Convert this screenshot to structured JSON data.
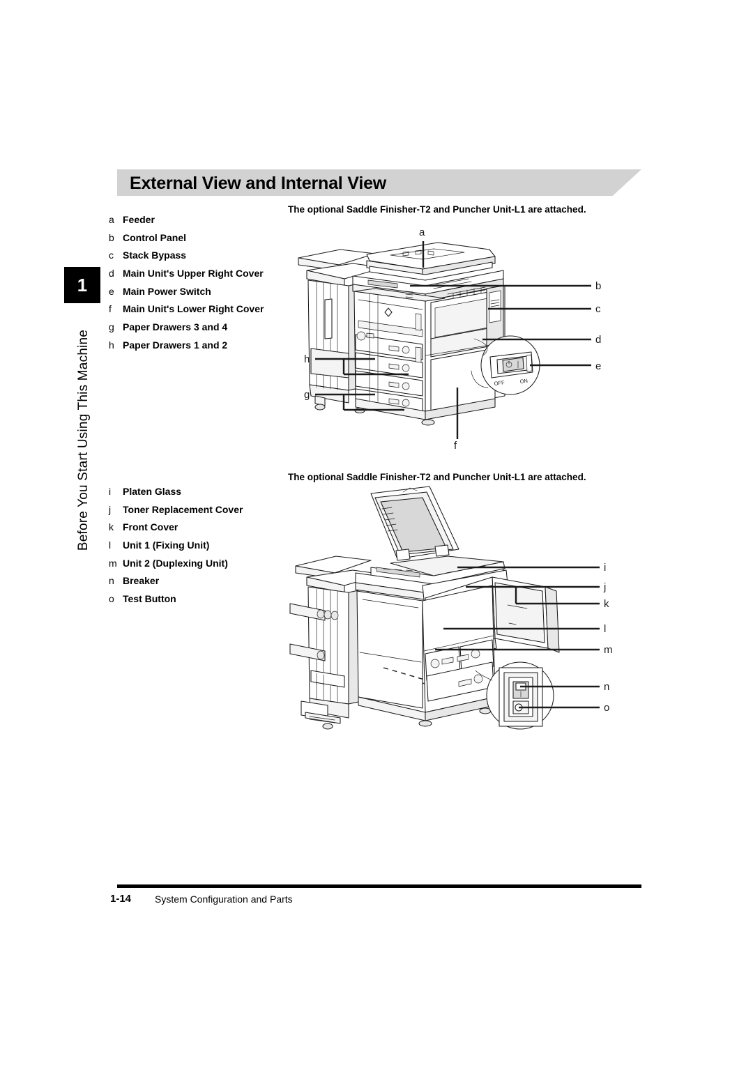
{
  "document": {
    "chapter_number": "1",
    "chapter_title": "Before You Start Using This Machine",
    "section_title": "External View and Internal View",
    "footer": {
      "page_number": "1-14",
      "section_name": "System Configuration and Parts"
    }
  },
  "figures": [
    {
      "caption": "The optional Saddle Finisher-T2 and Puncher Unit-L1 are attached.",
      "callouts": [
        "a",
        "b",
        "c",
        "d",
        "e",
        "f",
        "g",
        "h"
      ],
      "switch_labels": {
        "off": "OFF",
        "on": "ON"
      }
    },
    {
      "caption": "The optional Saddle Finisher-T2 and Puncher Unit-L1 are attached.",
      "callouts": [
        "i",
        "j",
        "k",
        "l",
        "m",
        "n",
        "o"
      ]
    }
  ],
  "legend_1": [
    {
      "key": "a",
      "label": "Feeder"
    },
    {
      "key": "b",
      "label": "Control Panel"
    },
    {
      "key": "c",
      "label": "Stack Bypass"
    },
    {
      "key": "d",
      "label": "Main Unit's Upper Right Cover"
    },
    {
      "key": "e",
      "label": "Main Power Switch"
    },
    {
      "key": "f",
      "label": "Main Unit's Lower Right Cover"
    },
    {
      "key": "g",
      "label": "Paper Drawers 3 and 4"
    },
    {
      "key": "h",
      "label": "Paper Drawers 1 and 2"
    }
  ],
  "legend_2": [
    {
      "key": "i",
      "label": "Platen Glass"
    },
    {
      "key": "j",
      "label": "Toner Replacement Cover"
    },
    {
      "key": "k",
      "label": "Front Cover"
    },
    {
      "key": "l",
      "label": "Unit 1 (Fixing Unit)"
    },
    {
      "key": "m",
      "label": "Unit 2 (Duplexing Unit)"
    },
    {
      "key": "n",
      "label": "Breaker"
    },
    {
      "key": "o",
      "label": "Test Button"
    }
  ],
  "colors": {
    "band": "#d2d2d2",
    "tab": "#000000",
    "text": "#000000"
  }
}
